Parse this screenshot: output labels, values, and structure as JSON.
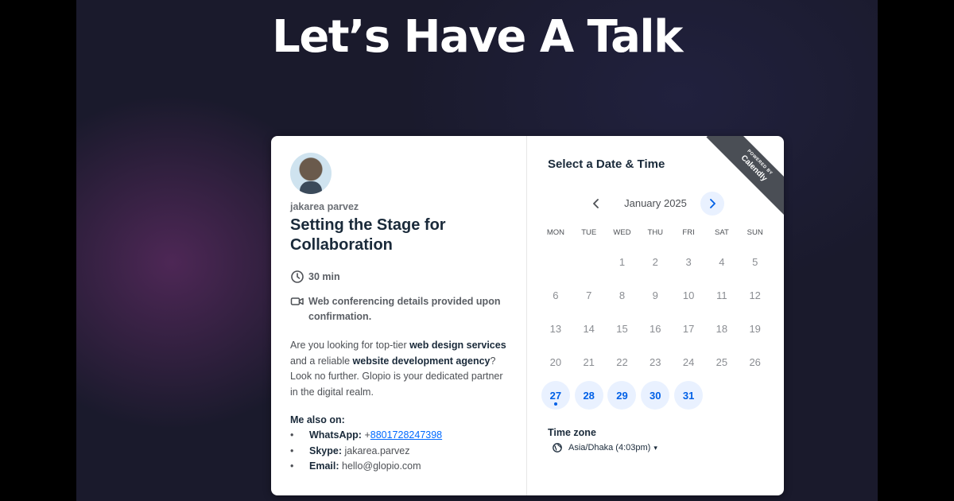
{
  "headline": "Let’s Have A Talk",
  "event": {
    "host": "jakarea parvez",
    "title": "Setting the Stage for Collaboration",
    "duration": "30 min",
    "conferencing": "Web conferencing details provided upon confirmation.",
    "description": {
      "p1": "Are you looking for top-tier ",
      "b1": "web design services",
      "p2": " and a reliable ",
      "b2": "website development agency",
      "p3": "? Look no further. Glopio is your dedicated partner in the digital realm."
    },
    "also_on": "Me also on:",
    "contacts": [
      {
        "label": "WhatsApp:",
        "prefix": " +",
        "value": "8801728247398"
      },
      {
        "label": "Skype:",
        "value": " jakarea.parvez"
      },
      {
        "label": "Email:",
        "value": " hello@glopio.com"
      }
    ]
  },
  "calendar": {
    "heading": "Select a Date & Time",
    "month": "January 2025",
    "weekdays": [
      "MON",
      "TUE",
      "WED",
      "THU",
      "FRI",
      "SAT",
      "SUN"
    ],
    "leading_blanks": 2,
    "days_in_month": 31,
    "available_days": [
      27,
      28,
      29,
      30,
      31
    ],
    "today": 27
  },
  "timezone": {
    "label": "Time zone",
    "value": "Asia/Dhaka (4:03pm)"
  },
  "badge": {
    "small": "POWERED BY",
    "brand": "Calendly"
  },
  "colors": {
    "accent": "#0069ff",
    "available_bg": "#e9f1ff"
  }
}
